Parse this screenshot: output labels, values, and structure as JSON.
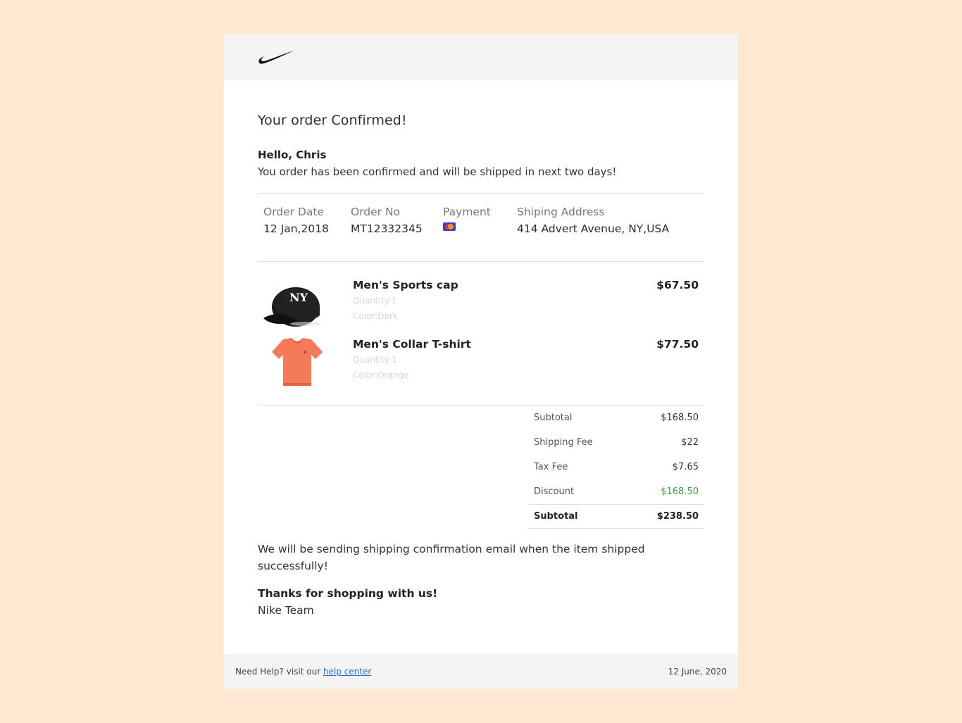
{
  "brand": {
    "logo_icon": "nike-swoosh-icon"
  },
  "heading": "Your order Confirmed!",
  "greeting": "Hello, Chris",
  "message": "You order has been confirmed and will be shipped in next two days!",
  "order_meta": {
    "date_label": "Order Date",
    "date_value": "12 Jan,2018",
    "number_label": "Order No",
    "number_value": "MT12332345",
    "payment_label": "Payment",
    "payment_icon": "mastercard-icon",
    "address_label": "Shiping Address",
    "address_value": "414 Advert Avenue, NY,USA"
  },
  "items": [
    {
      "name": "Men's Sports cap",
      "quantity": "Quantity:1",
      "color": "Color:Dark",
      "price": "$67.50",
      "image_icon": "cap-image"
    },
    {
      "name": "Men's Collar T-shirt",
      "quantity": "Quantity:1",
      "color": "Color:Orange",
      "price": "$77.50",
      "image_icon": "tshirt-image"
    }
  ],
  "totals": {
    "subtotal_label": "Subtotal",
    "subtotal_value": "$168.50",
    "shipping_label": "Shipping Fee",
    "shipping_value": "$22",
    "tax_label": "Tax Fee",
    "tax_value": "$7.65",
    "discount_label": "Discount",
    "discount_value": "$168.50",
    "total_label": "Subtotal",
    "total_value": "$238.50"
  },
  "closing": {
    "shipping_note": "We will be sending shipping confirmation email when the item shipped successfully!",
    "thanks": "Thanks for shopping with us!",
    "signoff": "Nike Team"
  },
  "footer": {
    "help_text": "Need Help? visit our ",
    "help_link": "help center",
    "date": "12 June, 2020"
  },
  "colors": {
    "page_background": "#ffe8d1",
    "discount": "#3aa03a",
    "link": "#2b6cd4"
  }
}
